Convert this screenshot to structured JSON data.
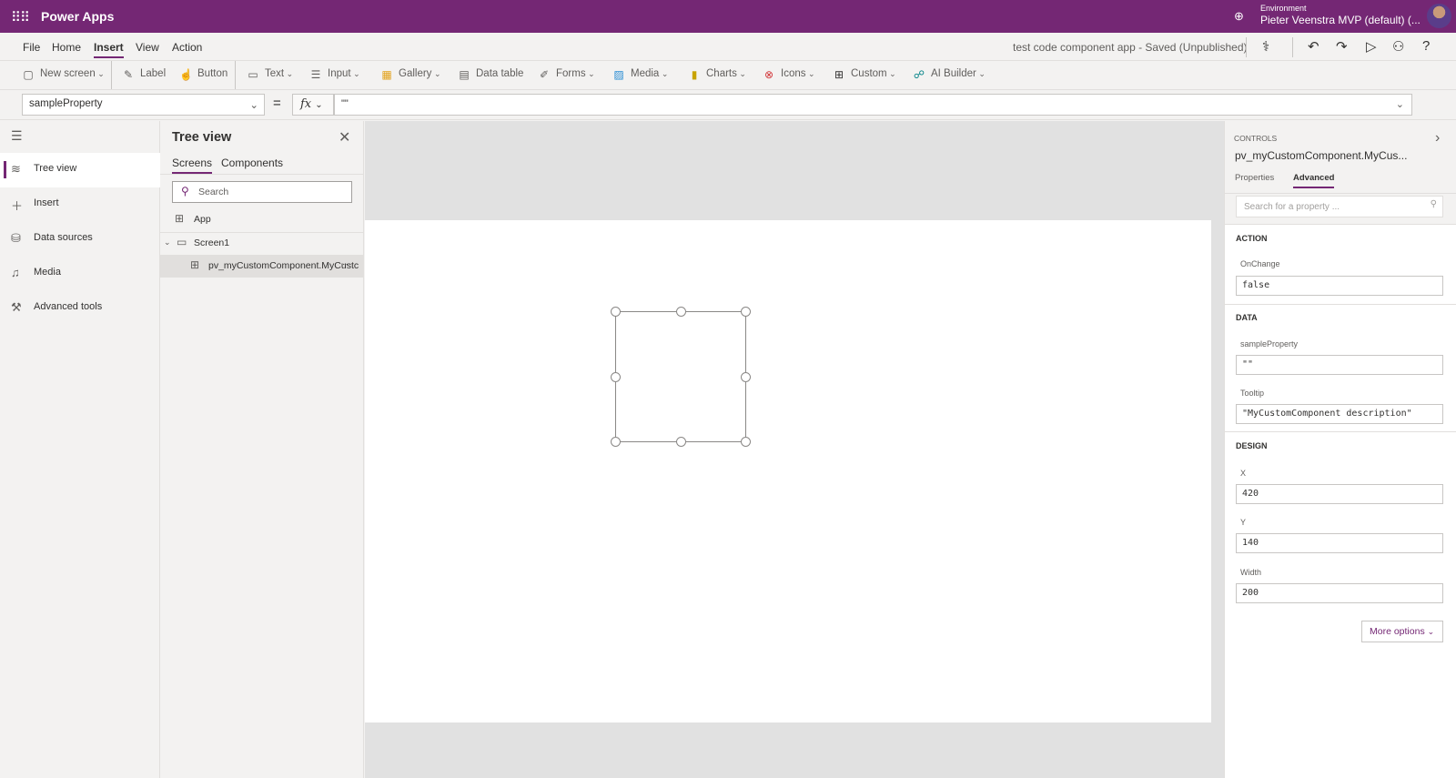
{
  "app": {
    "brand": "Power Apps",
    "env_label": "Environment",
    "env_name": "Pieter Veenstra MVP (default) (..."
  },
  "menu": {
    "items": [
      "File",
      "Home",
      "Insert",
      "View",
      "Action"
    ],
    "active": "Insert",
    "saved_status": "test code component app - Saved (Unpublished)"
  },
  "ribbon": {
    "items": [
      {
        "label": "New screen",
        "icon": "new-screen-icon",
        "chev": true,
        "ic": "▢"
      },
      {
        "label": "Label",
        "icon": "label-icon",
        "chev": false,
        "ic": "✎"
      },
      {
        "label": "Button",
        "icon": "button-icon",
        "chev": false,
        "ic": "☝"
      },
      {
        "label": "Text",
        "icon": "text-icon",
        "chev": true,
        "ic": "▭"
      },
      {
        "label": "Input",
        "icon": "input-icon",
        "chev": true,
        "ic": "☰"
      },
      {
        "label": "Gallery",
        "icon": "gallery-icon",
        "chev": true,
        "ic": "▦"
      },
      {
        "label": "Data table",
        "icon": "data-table-icon",
        "chev": false,
        "ic": "▤"
      },
      {
        "label": "Forms",
        "icon": "forms-icon",
        "chev": true,
        "ic": "✐"
      },
      {
        "label": "Media",
        "icon": "media-icon",
        "chev": true,
        "ic": "▨"
      },
      {
        "label": "Charts",
        "icon": "charts-icon",
        "chev": true,
        "ic": "▮"
      },
      {
        "label": "Icons",
        "icon": "icons-icon",
        "chev": true,
        "ic": "⊗"
      },
      {
        "label": "Custom",
        "icon": "custom-icon",
        "chev": true,
        "ic": "⊞"
      },
      {
        "label": "AI Builder",
        "icon": "ai-builder-icon",
        "chev": true,
        "ic": "☍"
      }
    ]
  },
  "formula": {
    "property": "sampleProperty",
    "fx": "fx",
    "value": "\"\""
  },
  "leftnav": {
    "items": [
      "Tree view",
      "Insert",
      "Data sources",
      "Media",
      "Advanced tools"
    ]
  },
  "tree": {
    "title": "Tree view",
    "tabs": [
      "Screens",
      "Components"
    ],
    "search_placeholder": "Search",
    "app": "App",
    "screen": "Screen1",
    "component": "pv_myCustomComponent.MyCustc",
    "more": "···"
  },
  "right": {
    "caption": "CONTROLS",
    "control": "pv_myCustomComponent.MyCus...",
    "tabs": [
      "Properties",
      "Advanced"
    ],
    "search_placeholder": "Search for a property ...",
    "sections": {
      "action": "ACTION",
      "data": "DATA",
      "design": "DESIGN"
    },
    "props": {
      "onchange_label": "OnChange",
      "onchange": "false",
      "sample_label": "sampleProperty",
      "sample": "\"\"",
      "tooltip_label": "Tooltip",
      "tooltip": "\"MyCustomComponent description\"",
      "x_label": "X",
      "x": "420",
      "y_label": "Y",
      "y": "140",
      "width_label": "Width",
      "width": "200"
    },
    "more_options": "More options"
  }
}
